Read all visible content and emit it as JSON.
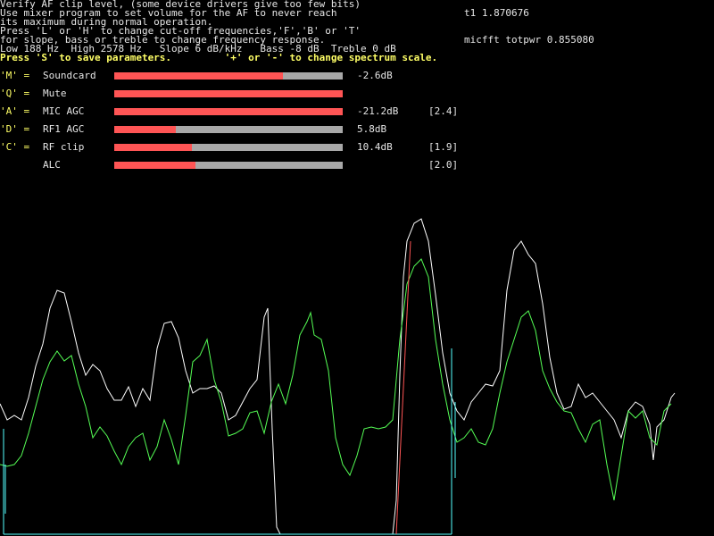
{
  "header": {
    "l1": "Verify AF clip level, (some device drivers give too few bits)",
    "l2": "Use mixer program to set volume for the AF to never reach",
    "t1": "t1 1.870676",
    "l3": "its maximum during normal operation.",
    "l4": "Press 'L' or 'H' to change cut-off frequencies,'F','B' or 'T'",
    "l5": "for slope, bass or treble to change frequency response.",
    "micfft": "micfft totpwr 0.855080",
    "l6": "Low 188 Hz  High 2578 Hz   Slope 6 dB/kHz   Bass -8 dB  Treble 0 dB",
    "l7": "Press 'S' to save parameters.         '+' or '-' to change spectrum scale."
  },
  "rows": [
    {
      "key": "'M' =",
      "label": "Soundcard",
      "fill": 0.74,
      "value": "-2.6dB",
      "bracket": ""
    },
    {
      "key": "'Q' =",
      "label": "Mute",
      "fill": 1.0,
      "value": "",
      "bracket": ""
    },
    {
      "key": "'A' =",
      "label": "MIC AGC",
      "fill": 1.0,
      "value": "-21.2dB",
      "bracket": "[2.4]"
    },
    {
      "key": "'D' =",
      "label": "RF1 AGC",
      "fill": 0.27,
      "value": "5.8dB",
      "bracket": ""
    },
    {
      "key": "'C' =",
      "label": "RF clip",
      "fill": 0.34,
      "value": "10.4dB",
      "bracket": "[1.9]"
    },
    {
      "key": "",
      "label": "ALC",
      "fill": 0.355,
      "value": "",
      "bracket": "[2.0]"
    }
  ],
  "colors": {
    "white_trace": "#ffffff",
    "green_trace": "#55ff55",
    "red_marker": "#ff5555",
    "cyan_marker": "#55ffff"
  }
}
